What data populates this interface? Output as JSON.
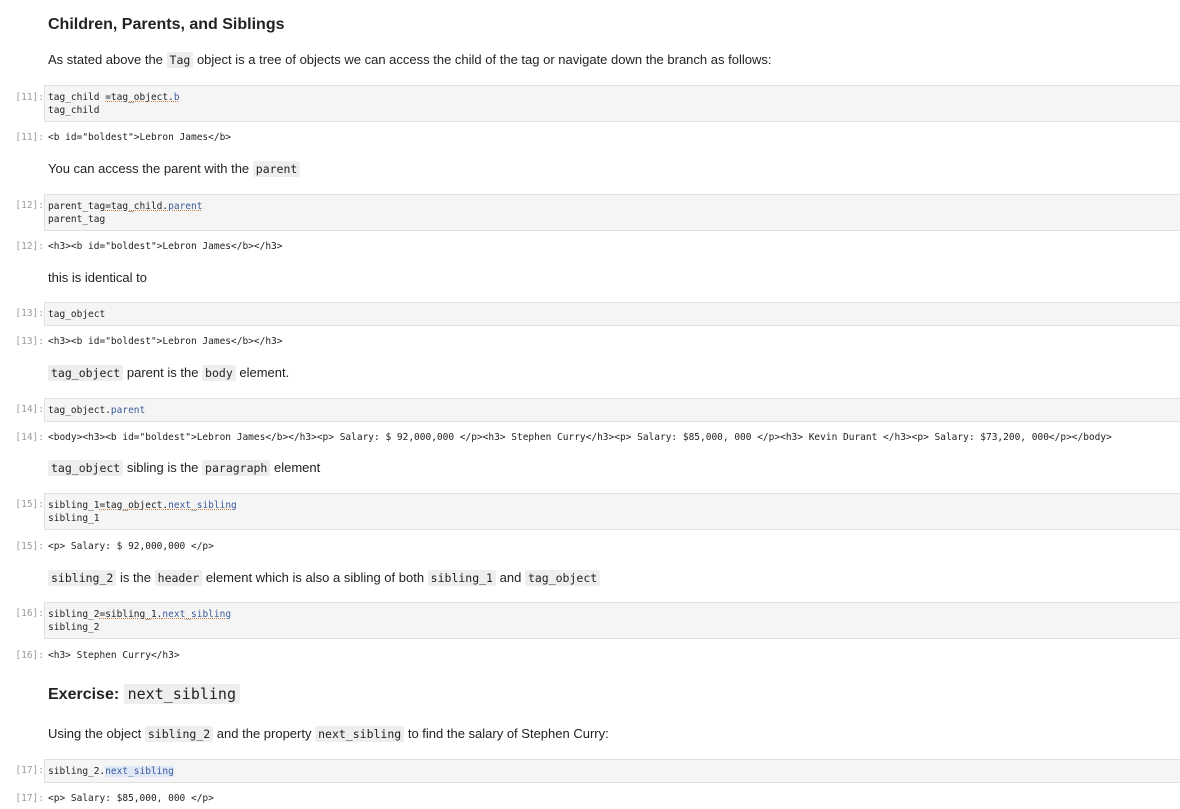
{
  "section": {
    "title": "Children, Parents, and Siblings",
    "intro_pre": "As stated above the",
    "intro_code": "Tag",
    "intro_post": "object is a tree of objects we can access the child of the tag or navigate down the branch as follows:"
  },
  "cells": {
    "c11": {
      "in_prompt": "[11]:",
      "line1_a": "tag_child ",
      "line1_b": "=tag_object.",
      "line1_c": "b",
      "line2": "tag_child",
      "out_prompt": "[11]:",
      "output": "<b id=\"boldest\">Lebron James</b>"
    },
    "c12": {
      "in_prompt": "[12]:",
      "line1_a": "parent_tag",
      "line1_b": "=tag_child.",
      "line1_c": "parent",
      "line2": "parent_tag",
      "out_prompt": "[12]:",
      "output": "<h3><b id=\"boldest\">Lebron James</b></h3>"
    },
    "c13": {
      "in_prompt": "[13]:",
      "line1": "tag_object",
      "out_prompt": "[13]:",
      "output": "<h3><b id=\"boldest\">Lebron James</b></h3>"
    },
    "c14": {
      "in_prompt": "[14]:",
      "line1_a": "tag_object.",
      "line1_b": "parent",
      "out_prompt": "[14]:",
      "output": "<body><h3><b id=\"boldest\">Lebron James</b></h3><p> Salary: $ 92,000,000 </p><h3> Stephen Curry</h3><p> Salary: $85,000, 000 </p><h3> Kevin Durant </h3><p> Salary: $73,200, 000</p></body>"
    },
    "c15": {
      "in_prompt": "[15]:",
      "line1_a": "sibling_1",
      "line1_b": "=tag_object.",
      "line1_c": "next_sibling",
      "line2": "sibling_1",
      "out_prompt": "[15]:",
      "output": "<p> Salary: $ 92,000,000 </p>"
    },
    "c16": {
      "in_prompt": "[16]:",
      "line1_a": "sibling_2",
      "line1_b": "=sibling_1.",
      "line1_c": "next_sibling",
      "line2": "sibling_2",
      "out_prompt": "[16]:",
      "output": "<h3> Stephen Curry</h3>"
    },
    "c17": {
      "in_prompt": "[17]:",
      "line1_a": "sibling_2.",
      "line1_b": "next_sibling",
      "out_prompt": "[17]:",
      "output": "<p> Salary: $85,000, 000 </p>"
    }
  },
  "md": {
    "parent_text": "You can access the parent with the",
    "parent_code": "parent",
    "identical": "this is identical to",
    "body_code1": "tag_object",
    "body_mid": "parent is the",
    "body_code2": "body",
    "body_end": "element.",
    "sib_code1": "tag_object",
    "sib_mid": "sibling is the",
    "sib_code2": "paragraph",
    "sib_end": "element",
    "s2_code1": "sibling_2",
    "s2_mid1": "is the",
    "s2_code2": "header",
    "s2_mid2": "element which is also a sibling of both",
    "s2_code3": "sibling_1",
    "s2_mid3": "and",
    "s2_code4": "tag_object"
  },
  "exercise": {
    "title": "Exercise:",
    "title_code": "next_sibling",
    "text_pre": "Using the object",
    "code1": "sibling_2",
    "text_mid": "and the property",
    "code2": "next_sibling",
    "text_post": "to find the salary of Stephen Curry:"
  }
}
